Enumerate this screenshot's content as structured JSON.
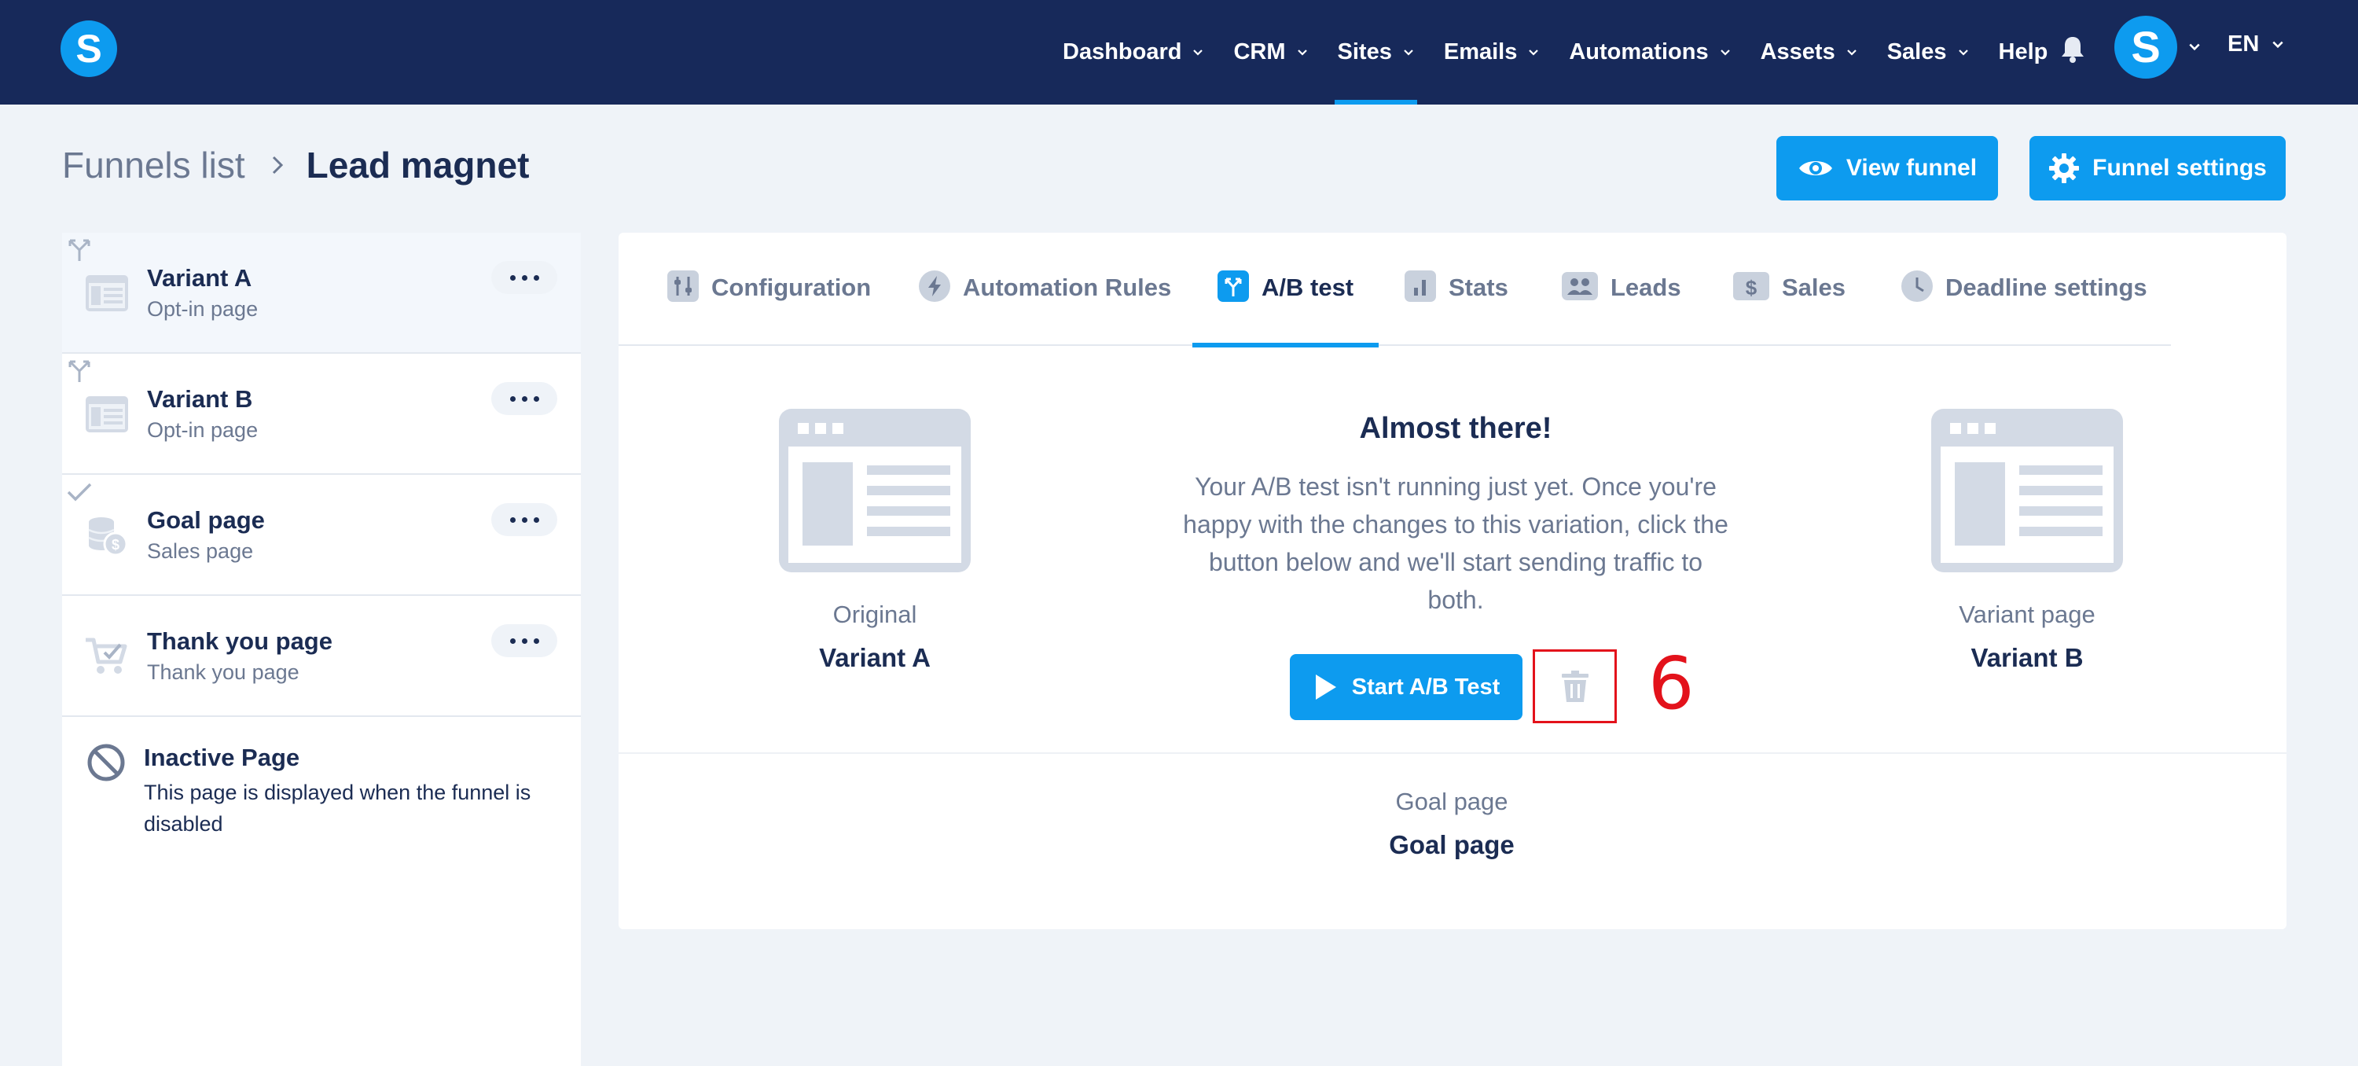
{
  "app": {
    "logo_letter": "S",
    "avatar_letter": "S",
    "language": "EN"
  },
  "nav": {
    "items": [
      {
        "label": "Dashboard",
        "dropdown": true,
        "active": false
      },
      {
        "label": "CRM",
        "dropdown": true,
        "active": false
      },
      {
        "label": "Sites",
        "dropdown": true,
        "active": true
      },
      {
        "label": "Emails",
        "dropdown": true,
        "active": false
      },
      {
        "label": "Automations",
        "dropdown": true,
        "active": false
      },
      {
        "label": "Assets",
        "dropdown": true,
        "active": false
      },
      {
        "label": "Sales",
        "dropdown": true,
        "active": false
      },
      {
        "label": "Help",
        "dropdown": false,
        "active": false
      }
    ]
  },
  "breadcrumb": {
    "parent": "Funnels list",
    "current": "Lead magnet"
  },
  "actions": {
    "view_funnel": "View funnel",
    "funnel_settings": "Funnel settings"
  },
  "sidebar": {
    "steps": [
      {
        "title": "Variant A",
        "subtitle": "Opt-in page",
        "marker": "split-icon",
        "icon": "opt-in-page-icon",
        "selected": true
      },
      {
        "title": "Variant B",
        "subtitle": "Opt-in page",
        "marker": "split-icon",
        "icon": "opt-in-page-icon",
        "selected": false
      },
      {
        "title": "Goal page",
        "subtitle": "Sales page",
        "marker": "check-icon",
        "icon": "sales-page-icon",
        "selected": false
      },
      {
        "title": "Thank you page",
        "subtitle": "Thank you page",
        "marker": "",
        "icon": "cart-check-icon",
        "selected": false
      }
    ],
    "inactive": {
      "title": "Inactive Page",
      "description": "This page is displayed when the funnel is disabled"
    }
  },
  "tabs": [
    {
      "label": "Configuration",
      "icon": "sliders-icon",
      "active": false
    },
    {
      "label": "Automation Rules",
      "icon": "lightning-icon",
      "active": false
    },
    {
      "label": "A/B test",
      "icon": "split-icon",
      "active": true
    },
    {
      "label": "Stats",
      "icon": "bar-chart-icon",
      "active": false
    },
    {
      "label": "Leads",
      "icon": "users-icon",
      "active": false
    },
    {
      "label": "Sales",
      "icon": "dollar-icon",
      "active": false
    },
    {
      "label": "Deadline settings",
      "icon": "clock-icon",
      "active": false
    }
  ],
  "ab_test": {
    "original": {
      "label": "Original",
      "name": "Variant A"
    },
    "variant": {
      "label": "Variant page",
      "name": "Variant B"
    },
    "heading": "Almost there!",
    "description": "Your A/B test isn't running just yet. Once you're happy with the changes to this variation, click the button below and we'll start sending traffic to both.",
    "start_button": "Start A/B Test",
    "annotation_number": "6",
    "goal": {
      "label": "Goal page",
      "name": "Goal page"
    }
  },
  "colors": {
    "nav_bg": "#17295a",
    "accent": "#0d9bef",
    "page_bg": "#eff3f8",
    "text_dark": "#1b2c53",
    "text_muted": "#6b7891",
    "annotation_red": "#e3121b"
  }
}
